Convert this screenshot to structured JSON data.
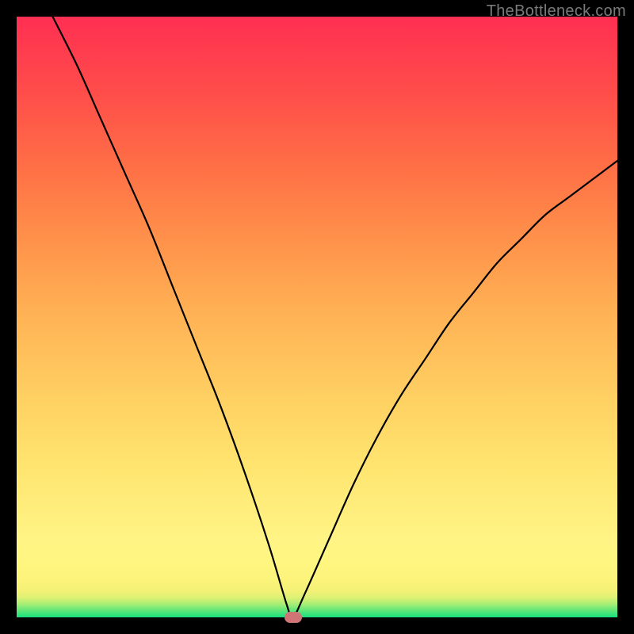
{
  "watermark": "TheBottleneck.com",
  "colors": {
    "frame": "#000000",
    "curve": "#000000",
    "marker": "#cf7575",
    "watermark": "#7a7a7a"
  },
  "chart_data": {
    "type": "line",
    "title": "",
    "xlabel": "",
    "ylabel": "",
    "xlim": [
      0,
      100
    ],
    "ylim": [
      0,
      100
    ],
    "gradient_axis": "y",
    "gradient_meaning": "bottleneck_severity_low_to_high",
    "marker": {
      "x": 46,
      "y": 0
    },
    "series": [
      {
        "name": "bottleneck-curve",
        "x": [
          6,
          10,
          14,
          18,
          22,
          26,
          30,
          34,
          38,
          42,
          45,
          46,
          48,
          52,
          56,
          60,
          64,
          68,
          72,
          76,
          80,
          84,
          88,
          92,
          96,
          100
        ],
        "values": [
          100,
          92,
          83,
          74,
          65,
          55,
          45,
          35,
          24,
          12,
          2,
          0,
          4,
          13,
          22,
          30,
          37,
          43,
          49,
          54,
          59,
          63,
          67,
          70,
          73,
          76
        ]
      }
    ]
  }
}
